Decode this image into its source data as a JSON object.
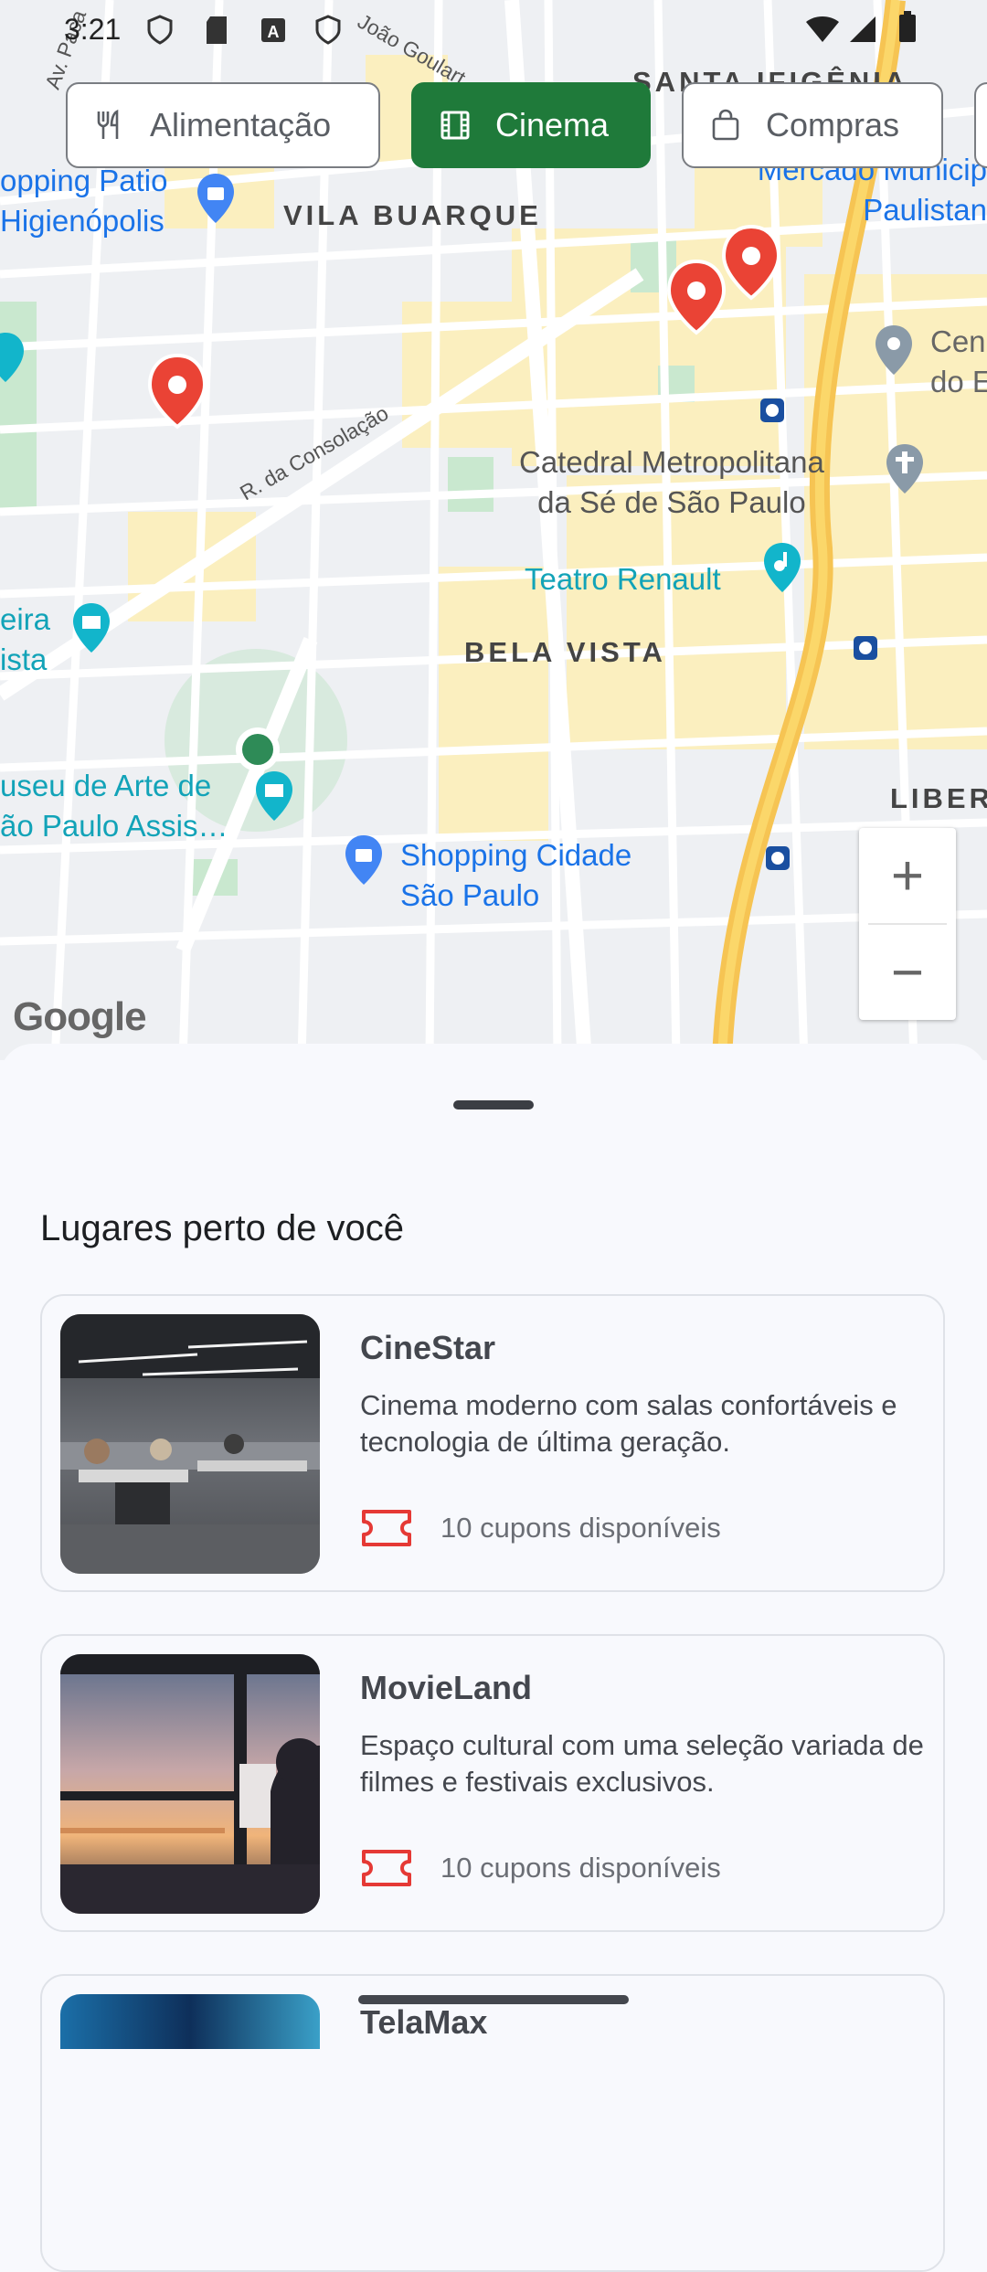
{
  "status_bar": {
    "time": "3:21"
  },
  "filters": [
    {
      "label": "Alimentação",
      "icon": "fork-knife-icon",
      "active": false
    },
    {
      "label": "Cinema",
      "icon": "film-icon",
      "active": true
    },
    {
      "label": "Compras",
      "icon": "shopping-bag-icon",
      "active": false
    }
  ],
  "map": {
    "labels": {
      "santa_ifigenia": "SANTA IFIGÊNIA",
      "vila_buarque": "VILA BUARQUE",
      "bela_vista": "BELA VISTA",
      "liberdade": "LIBER",
      "shopping_patio_1": "opping Patio",
      "shopping_patio_2": "Higienópolis",
      "mercado_1": "Mercado Municip",
      "mercado_2": "Paulistan",
      "cen_1": "Cen",
      "cen_2": "do E",
      "catedral_1": "Catedral Metropolitana",
      "catedral_2": "da Sé de São Paulo",
      "teatro": "Teatro Renault",
      "eira_1": "eira",
      "eira_2": "ista",
      "museu_1": "useu de Arte de",
      "museu_2": "ão Paulo Assis…",
      "shopping_cidade_1": "Shopping Cidade",
      "shopping_cidade_2": "São Paulo",
      "street_consolacao": "R. da Consolação",
      "street_goulart": "João Goulart",
      "street_av": "Av. Paca"
    },
    "zoom_in": "+",
    "zoom_out": "−",
    "attribution": "Google"
  },
  "sheet": {
    "title": "Lugares perto de você",
    "places": [
      {
        "name": "CineStar",
        "description": "Cinema moderno com salas confortáveis e tecnologia de última geração.",
        "coupons": "10 cupons disponíveis"
      },
      {
        "name": "MovieLand",
        "description": "Espaço cultural com uma seleção variada de filmes e festivais exclusivos.",
        "coupons": "10 cupons disponíveis"
      },
      {
        "name": "TelaMax",
        "description": "",
        "coupons": ""
      }
    ]
  },
  "colors": {
    "accent": "#1f7a3a",
    "coupon": "#e53935",
    "poi_blue": "#1a73e8",
    "pin_red": "#ea4335"
  }
}
